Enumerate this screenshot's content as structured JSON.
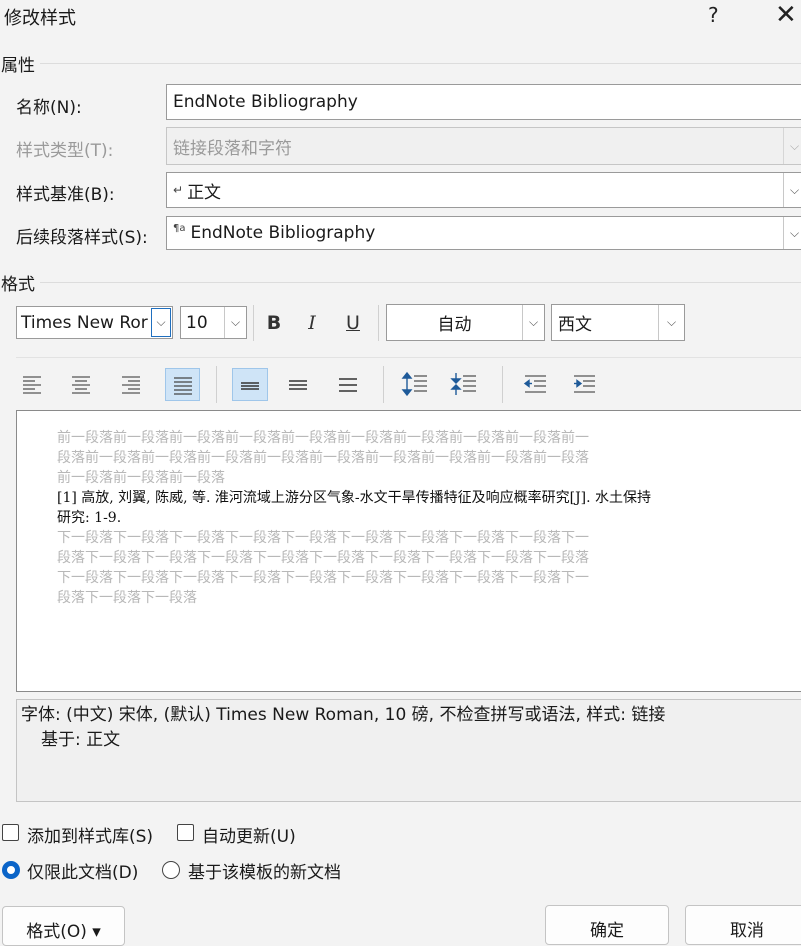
{
  "window": {
    "title": "修改样式",
    "help": "?",
    "close": "✕"
  },
  "properties": {
    "section": "属性",
    "name_label": "名称(N):",
    "name_value": "EndNote Bibliography",
    "type_label": "样式类型(T):",
    "type_value": "链接段落和字符",
    "base_label": "样式基准(B):",
    "base_value": "正文",
    "base_glyph": "↵",
    "next_label": "后续段落样式(S):",
    "next_value": "EndNote Bibliography",
    "next_glyph": "¶a"
  },
  "format": {
    "section": "格式",
    "font": "Times New Ror",
    "size": "10",
    "bold": "B",
    "italic": "I",
    "underline": "U",
    "color": "自动",
    "script": "西文"
  },
  "toolbar2": {
    "align_left": "align-left-icon",
    "align_center": "align-center-icon",
    "align_right": "align-right-icon",
    "align_justify": "align-justify-icon",
    "spacing_single": "line-spacing-single-icon",
    "spacing_one_half": "line-spacing-1.5-icon",
    "spacing_double": "line-spacing-double-icon",
    "increase_spacing": "increase-paragraph-spacing-icon",
    "decrease_spacing": "decrease-paragraph-spacing-icon",
    "decrease_indent": "decrease-indent-icon",
    "increase_indent": "increase-indent-icon",
    "active_color": "#cfe4f7"
  },
  "preview": {
    "prev_lines": [
      "前一段落前一段落前一段落前一段落前一段落前一段落前一段落前一段落前一段落前一",
      "段落前一段落前一段落前一段落前一段落前一段落前一段落前一段落前一段落前一段落",
      "前一段落前一段落前一段落"
    ],
    "main_lines": [
      "[1]  高放, 刘翼, 陈威, 等. 淮河流域上游分区气象-水文干旱传播特征及响应概率研究[J]. 水土保持",
      "研究: 1-9."
    ],
    "next_lines": [
      "下一段落下一段落下一段落下一段落下一段落下一段落下一段落下一段落下一段落下一",
      "段落下一段落下一段落下一段落下一段落下一段落下一段落下一段落下一段落下一段落",
      "下一段落下一段落下一段落下一段落下一段落下一段落下一段落下一段落下一段落下一",
      "段落下一段落下一段落"
    ]
  },
  "description": {
    "line1": "字体: (中文) 宋体, (默认) Times New Roman, 10 磅, 不检查拼写或语法, 样式: 链接",
    "line2": "基于: 正文"
  },
  "options": {
    "add_to_gallery": "添加到样式库(S)",
    "auto_update": "自动更新(U)",
    "this_document": "仅限此文档(D)",
    "new_documents": "基于该模板的新文档",
    "radio_accent": "#0a64c8"
  },
  "buttons": {
    "format": "格式(O) ▾",
    "ok": "确定",
    "cancel": "取消"
  }
}
